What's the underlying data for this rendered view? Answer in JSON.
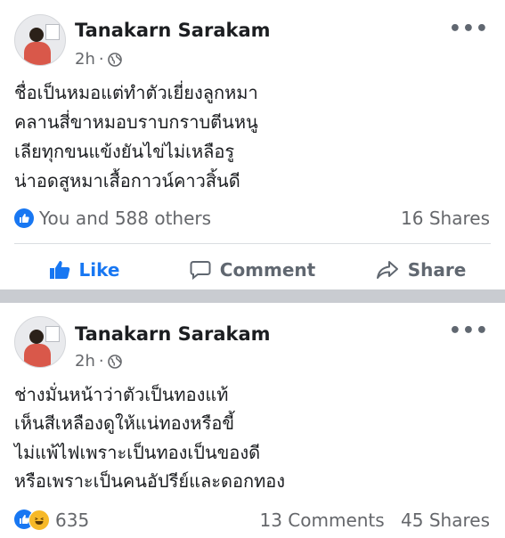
{
  "posts": [
    {
      "author": "Tanakarn Sarakam",
      "timestamp": "2h",
      "privacy_icon": "globe-icon",
      "lines": [
        "ชื่อเป็นหมอแต่ทำตัวเยี่ยงลูกหมา",
        "คลานสี่ขาหมอบราบกราบตีนหนู",
        "เลียทุกขนแข้งยันไข่ไม่เหลือรู",
        "น่าอดสูหมาเสื้อกาวน์คาวสิ้นดี"
      ],
      "reactions_text": "You and 588 others",
      "shares": "16 Shares",
      "actions": {
        "like": "Like",
        "comment": "Comment",
        "share": "Share"
      }
    },
    {
      "author": "Tanakarn Sarakam",
      "timestamp": "2h",
      "privacy_icon": "globe-icon",
      "lines": [
        "ช่างมั่นหน้าว่าตัวเป็นทองแท้",
        "เห็นสีเหลืองดูให้แน่ทองหรือขี้",
        "ไม่แพ้ไฟเพราะเป็นทองเป็นของดี",
        "หรือเพราะเป็นคนอัปรีย์และดอกทอง"
      ],
      "reactions_text": "635",
      "comments": "13 Comments",
      "shares": "45 Shares"
    }
  ],
  "colors": {
    "accent": "#1877f2",
    "muted": "#65676b",
    "divider": "#c9ccd1"
  }
}
